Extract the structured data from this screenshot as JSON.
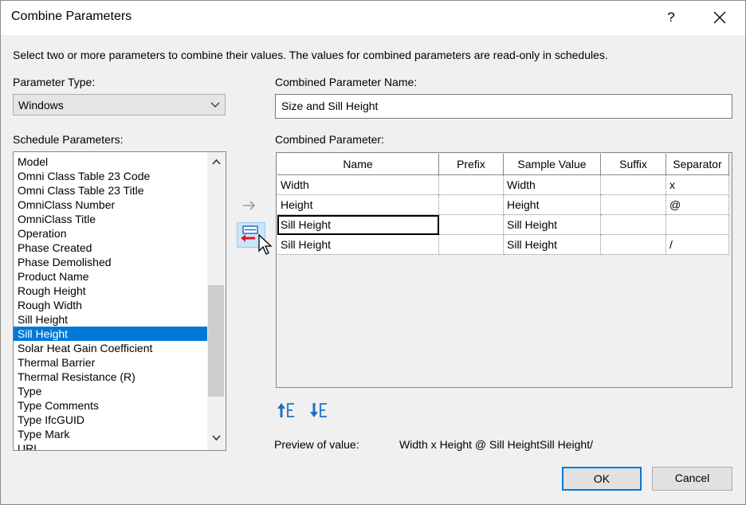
{
  "window": {
    "title": "Combine Parameters",
    "help_label": "?"
  },
  "instruction": "Select two or more parameters to combine their values.  The values for combined parameters are read-only in schedules.",
  "parameter_type": {
    "label": "Parameter Type:",
    "value": "Windows"
  },
  "combined_name": {
    "label": "Combined Parameter Name:",
    "value": "Size and Sill Height"
  },
  "schedule_parameters": {
    "label": "Schedule Parameters:",
    "items": [
      "Model",
      "Omni Class Table 23 Code",
      "Omni Class Table 23 Title",
      "OmniClass Number",
      "OmniClass Title",
      "Operation",
      "Phase Created",
      "Phase Demolished",
      "Product Name",
      "Rough Height",
      "Rough Width",
      "Sill Height",
      "Sill Height",
      "Solar Heat Gain Coefficient",
      "Thermal Barrier",
      "Thermal Resistance (R)",
      "Type",
      "Type Comments",
      "Type IfcGUID",
      "Type Mark",
      "URL"
    ],
    "selected_index": 12
  },
  "combined_parameter": {
    "label": "Combined Parameter:",
    "columns": [
      "Name",
      "Prefix",
      "Sample Value",
      "Suffix",
      "Separator"
    ],
    "rows": [
      {
        "name": "Width",
        "prefix": "",
        "sample": "Width",
        "suffix": "",
        "separator": "x"
      },
      {
        "name": "Height",
        "prefix": "",
        "sample": "Height",
        "suffix": "",
        "separator": "@"
      },
      {
        "name": "Sill Height",
        "prefix": "",
        "sample": "Sill Height",
        "suffix": "",
        "separator": ""
      },
      {
        "name": "Sill Height",
        "prefix": "",
        "sample": "Sill Height",
        "suffix": "",
        "separator": "/"
      }
    ]
  },
  "preview": {
    "label": "Preview of value:",
    "value": "Width x Height @ Sill HeightSill Height/"
  },
  "buttons": {
    "ok": "OK",
    "cancel": "Cancel"
  },
  "colors": {
    "selection": "#0078d7",
    "dialog_bg": "#f0f0f0",
    "remove_arrow": "#e81123",
    "move_icon": "#1e6fc4"
  },
  "icons": {
    "add": "right-arrow-icon",
    "remove": "remove-parameter-icon",
    "move_up": "move-up-icon",
    "move_down": "move-down-icon",
    "close": "close-icon"
  }
}
